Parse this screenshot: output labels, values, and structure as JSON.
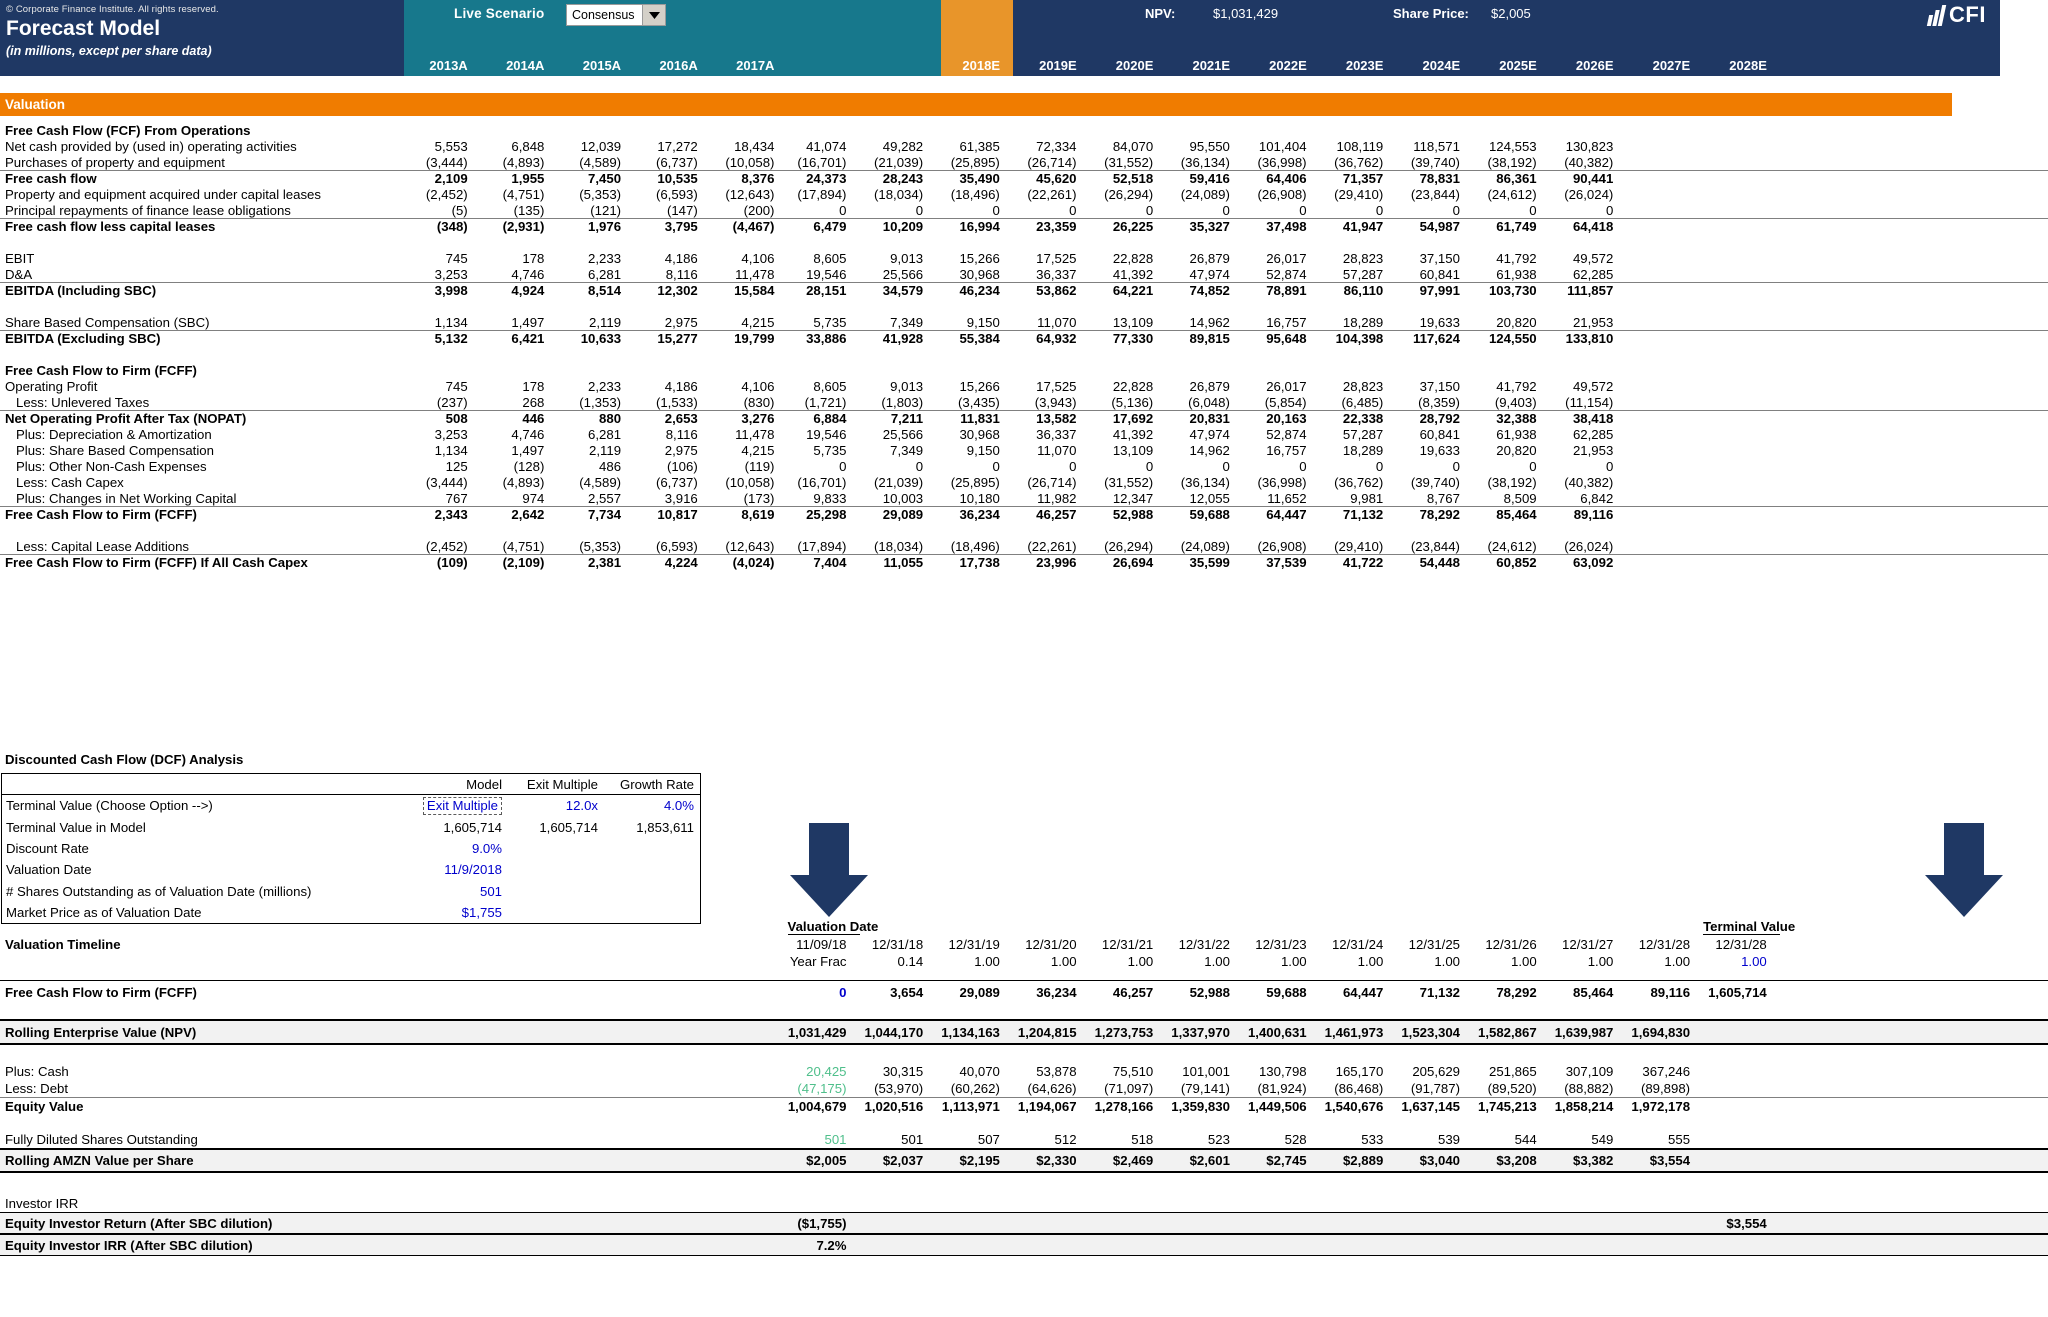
{
  "header": {
    "copyright": "© Corporate Finance Institute. All rights reserved.",
    "title": "Forecast Model",
    "subtitle": "(in millions, except per share data)",
    "live_scenario_label": "Live Scenario",
    "scenario_value": "Consensus",
    "npv_label": "NPV:",
    "npv_value": "$1,031,429",
    "share_price_label": "Share Price:",
    "share_price_value": "$2,005",
    "logo_text": "CFI"
  },
  "valuation_bar": "Valuation",
  "years": [
    "2013A",
    "2014A",
    "2015A",
    "2016A",
    "2017A",
    "2018E",
    "2019E",
    "2020E",
    "2021E",
    "2022E",
    "2023E",
    "2024E",
    "2025E",
    "2026E",
    "2027E",
    "2028E"
  ],
  "sections": {
    "fcf_ops": {
      "heading": "Free Cash Flow (FCF) From Operations",
      "rows": [
        {
          "label": "Net cash provided by (used in) operating activities",
          "values": [
            "5,553",
            "6,848",
            "12,039",
            "17,272",
            "18,434",
            "41,074",
            "49,282",
            "61,385",
            "72,334",
            "84,070",
            "95,550",
            "101,404",
            "108,119",
            "118,571",
            "124,553",
            "130,823"
          ]
        },
        {
          "label": "Purchases of property and equipment",
          "values": [
            "(3,444)",
            "(4,893)",
            "(4,589)",
            "(6,737)",
            "(10,058)",
            "(16,701)",
            "(21,039)",
            "(25,895)",
            "(26,714)",
            "(31,552)",
            "(36,134)",
            "(36,998)",
            "(36,762)",
            "(39,740)",
            "(38,192)",
            "(40,382)"
          ]
        },
        {
          "label": "Free cash flow",
          "bold": true,
          "rule": "top",
          "values": [
            "2,109",
            "1,955",
            "7,450",
            "10,535",
            "8,376",
            "24,373",
            "28,243",
            "35,490",
            "45,620",
            "52,518",
            "59,416",
            "64,406",
            "71,357",
            "78,831",
            "86,361",
            "90,441"
          ]
        },
        {
          "label": "Property and equipment acquired under capital leases",
          "values": [
            "(2,452)",
            "(4,751)",
            "(5,353)",
            "(6,593)",
            "(12,643)",
            "(17,894)",
            "(18,034)",
            "(18,496)",
            "(22,261)",
            "(26,294)",
            "(24,089)",
            "(26,908)",
            "(29,410)",
            "(23,844)",
            "(24,612)",
            "(26,024)"
          ]
        },
        {
          "label": "Principal repayments of finance lease obligations",
          "values": [
            "(5)",
            "(135)",
            "(121)",
            "(147)",
            "(200)",
            "0",
            "0",
            "0",
            "0",
            "0",
            "0",
            "0",
            "0",
            "0",
            "0",
            "0"
          ]
        },
        {
          "label": "Free cash flow less capital leases",
          "bold": true,
          "rule": "top",
          "values": [
            "(348)",
            "(2,931)",
            "1,976",
            "3,795",
            "(4,467)",
            "6,479",
            "10,209",
            "16,994",
            "23,359",
            "26,225",
            "35,327",
            "37,498",
            "41,947",
            "54,987",
            "61,749",
            "64,418"
          ]
        }
      ]
    },
    "ebitda": {
      "rows": [
        {
          "label": "EBIT",
          "values": [
            "745",
            "178",
            "2,233",
            "4,186",
            "4,106",
            "8,605",
            "9,013",
            "15,266",
            "17,525",
            "22,828",
            "26,879",
            "26,017",
            "28,823",
            "37,150",
            "41,792",
            "49,572"
          ]
        },
        {
          "label": "D&A",
          "values": [
            "3,253",
            "4,746",
            "6,281",
            "8,116",
            "11,478",
            "19,546",
            "25,566",
            "30,968",
            "36,337",
            "41,392",
            "47,974",
            "52,874",
            "57,287",
            "60,841",
            "61,938",
            "62,285"
          ]
        },
        {
          "label": "EBITDA (Including SBC)",
          "bold": true,
          "rule": "top",
          "values": [
            "3,998",
            "4,924",
            "8,514",
            "12,302",
            "15,584",
            "28,151",
            "34,579",
            "46,234",
            "53,862",
            "64,221",
            "74,852",
            "78,891",
            "86,110",
            "97,991",
            "103,730",
            "111,857"
          ]
        },
        {
          "label": "Share Based Compensation (SBC)",
          "spacer_before": true,
          "values": [
            "1,134",
            "1,497",
            "2,119",
            "2,975",
            "4,215",
            "5,735",
            "7,349",
            "9,150",
            "11,070",
            "13,109",
            "14,962",
            "16,757",
            "18,289",
            "19,633",
            "20,820",
            "21,953"
          ]
        },
        {
          "label": "EBITDA (Excluding SBC)",
          "bold": true,
          "rule": "top",
          "values": [
            "5,132",
            "6,421",
            "10,633",
            "15,277",
            "19,799",
            "33,886",
            "41,928",
            "55,384",
            "64,932",
            "77,330",
            "89,815",
            "95,648",
            "104,398",
            "117,624",
            "124,550",
            "133,810"
          ]
        }
      ]
    },
    "fcff": {
      "heading": "Free Cash Flow to Firm (FCFF)",
      "rows": [
        {
          "label": "Operating Profit",
          "values": [
            "745",
            "178",
            "2,233",
            "4,186",
            "4,106",
            "8,605",
            "9,013",
            "15,266",
            "17,525",
            "22,828",
            "26,879",
            "26,017",
            "28,823",
            "37,150",
            "41,792",
            "49,572"
          ]
        },
        {
          "label": "Less: Unlevered Taxes",
          "indent": true,
          "values": [
            "(237)",
            "268",
            "(1,353)",
            "(1,533)",
            "(830)",
            "(1,721)",
            "(1,803)",
            "(3,435)",
            "(3,943)",
            "(5,136)",
            "(6,048)",
            "(5,854)",
            "(6,485)",
            "(8,359)",
            "(9,403)",
            "(11,154)"
          ]
        },
        {
          "label": "Net Operating Profit After Tax (NOPAT)",
          "bold": true,
          "rule": "top",
          "values": [
            "508",
            "446",
            "880",
            "2,653",
            "3,276",
            "6,884",
            "7,211",
            "11,831",
            "13,582",
            "17,692",
            "20,831",
            "20,163",
            "22,338",
            "28,792",
            "32,388",
            "38,418"
          ]
        },
        {
          "label": "Plus: Depreciation & Amortization",
          "indent": true,
          "values": [
            "3,253",
            "4,746",
            "6,281",
            "8,116",
            "11,478",
            "19,546",
            "25,566",
            "30,968",
            "36,337",
            "41,392",
            "47,974",
            "52,874",
            "57,287",
            "60,841",
            "61,938",
            "62,285"
          ]
        },
        {
          "label": "Plus: Share Based Compensation",
          "indent": true,
          "values": [
            "1,134",
            "1,497",
            "2,119",
            "2,975",
            "4,215",
            "5,735",
            "7,349",
            "9,150",
            "11,070",
            "13,109",
            "14,962",
            "16,757",
            "18,289",
            "19,633",
            "20,820",
            "21,953"
          ]
        },
        {
          "label": "Plus: Other Non-Cash Expenses",
          "indent": true,
          "values": [
            "125",
            "(128)",
            "486",
            "(106)",
            "(119)",
            "0",
            "0",
            "0",
            "0",
            "0",
            "0",
            "0",
            "0",
            "0",
            "0",
            "0"
          ]
        },
        {
          "label": "Less: Cash Capex",
          "indent": true,
          "values": [
            "(3,444)",
            "(4,893)",
            "(4,589)",
            "(6,737)",
            "(10,058)",
            "(16,701)",
            "(21,039)",
            "(25,895)",
            "(26,714)",
            "(31,552)",
            "(36,134)",
            "(36,998)",
            "(36,762)",
            "(39,740)",
            "(38,192)",
            "(40,382)"
          ]
        },
        {
          "label": "Plus: Changes in Net Working Capital",
          "indent": true,
          "values": [
            "767",
            "974",
            "2,557",
            "3,916",
            "(173)",
            "9,833",
            "10,003",
            "10,180",
            "11,982",
            "12,347",
            "12,055",
            "11,652",
            "9,981",
            "8,767",
            "8,509",
            "6,842"
          ]
        },
        {
          "label": "Free Cash Flow to Firm (FCFF)",
          "bold": true,
          "rule": "top",
          "values": [
            "2,343",
            "2,642",
            "7,734",
            "10,817",
            "8,619",
            "25,298",
            "29,089",
            "36,234",
            "46,257",
            "52,988",
            "59,688",
            "64,447",
            "71,132",
            "78,292",
            "85,464",
            "89,116"
          ]
        },
        {
          "label": "Less: Capital Lease Additions",
          "indent": true,
          "spacer_before": true,
          "values": [
            "(2,452)",
            "(4,751)",
            "(5,353)",
            "(6,593)",
            "(12,643)",
            "(17,894)",
            "(18,034)",
            "(18,496)",
            "(22,261)",
            "(26,294)",
            "(24,089)",
            "(26,908)",
            "(29,410)",
            "(23,844)",
            "(24,612)",
            "(26,024)"
          ]
        },
        {
          "label": "Free Cash Flow to Firm (FCFF) If All Cash Capex",
          "bold": true,
          "rule": "top",
          "values": [
            "(109)",
            "(2,109)",
            "2,381",
            "4,224",
            "(4,024)",
            "7,404",
            "11,055",
            "17,738",
            "23,996",
            "26,694",
            "35,599",
            "37,539",
            "41,722",
            "54,448",
            "60,852",
            "63,092"
          ]
        }
      ]
    }
  },
  "dcf": {
    "title": "Discounted Cash Flow (DCF) Analysis",
    "columns": [
      "Model",
      "Exit Multiple",
      "Growth Rate"
    ],
    "rows": [
      {
        "label": "Terminal Value (Choose Option -->)",
        "model": "Exit Multiple",
        "model_style": "dashed-blue",
        "exit": "12.0x",
        "growth": "4.0%"
      },
      {
        "label": "Terminal Value in Model",
        "model": "1,605,714",
        "exit": "1,605,714",
        "growth": "1,853,611"
      },
      {
        "label": "Discount Rate",
        "model": "9.0%",
        "model_style": "blue",
        "exit": "",
        "growth": ""
      },
      {
        "label": "Valuation Date",
        "model": "11/9/2018",
        "model_style": "blue",
        "exit": "",
        "growth": ""
      },
      {
        "label": "# Shares Outstanding as of Valuation Date (millions)",
        "model": "501",
        "model_style": "blue",
        "exit": "",
        "growth": ""
      },
      {
        "label": "Market Price as of Valuation Date",
        "model": "$1,755",
        "model_style": "blue",
        "exit": "",
        "growth": ""
      }
    ]
  },
  "timeline": {
    "valuation_date_caption": "Valuation Date",
    "terminal_value_caption": "Terminal Value",
    "row_label": "Valuation Timeline",
    "year_frac_label": "Year Frac",
    "dates": [
      "11/09/18",
      "12/31/18",
      "12/31/19",
      "12/31/20",
      "12/31/21",
      "12/31/22",
      "12/31/23",
      "12/31/24",
      "12/31/25",
      "12/31/26",
      "12/31/27",
      "12/31/28",
      "12/31/28"
    ],
    "year_fracs": [
      "",
      "0.14",
      "1.00",
      "1.00",
      "1.00",
      "1.00",
      "1.00",
      "1.00",
      "1.00",
      "1.00",
      "1.00",
      "1.00",
      "1.00"
    ]
  },
  "valuation_rows": {
    "fcff": {
      "label": "Free Cash Flow to Firm (FCFF)",
      "values": [
        "0",
        "3,654",
        "29,089",
        "36,234",
        "46,257",
        "52,988",
        "59,688",
        "64,447",
        "71,132",
        "78,292",
        "85,464",
        "89,116",
        "1,605,714"
      ]
    },
    "rolling_ev": {
      "label": "Rolling Enterprise Value (NPV)",
      "values": [
        "1,031,429",
        "1,044,170",
        "1,134,163",
        "1,204,815",
        "1,273,753",
        "1,337,970",
        "1,400,631",
        "1,461,973",
        "1,523,304",
        "1,582,867",
        "1,639,987",
        "1,694,830",
        ""
      ]
    },
    "plus_cash": {
      "label": "Plus: Cash",
      "values": [
        "20,425",
        "30,315",
        "40,070",
        "53,878",
        "75,510",
        "101,001",
        "130,798",
        "165,170",
        "205,629",
        "251,865",
        "307,109",
        "367,246",
        ""
      ]
    },
    "less_debt": {
      "label": "Less: Debt",
      "values": [
        "(47,175)",
        "(53,970)",
        "(60,262)",
        "(64,626)",
        "(71,097)",
        "(79,141)",
        "(81,924)",
        "(86,468)",
        "(91,787)",
        "(89,520)",
        "(88,882)",
        "(89,898)",
        ""
      ]
    },
    "equity_value": {
      "label": "Equity Value",
      "values": [
        "1,004,679",
        "1,020,516",
        "1,113,971",
        "1,194,067",
        "1,278,166",
        "1,359,830",
        "1,449,506",
        "1,540,676",
        "1,637,145",
        "1,745,213",
        "1,858,214",
        "1,972,178",
        ""
      ]
    },
    "shares": {
      "label": "Fully Diluted Shares Outstanding",
      "values": [
        "501",
        "501",
        "507",
        "512",
        "518",
        "523",
        "528",
        "533",
        "539",
        "544",
        "549",
        "555",
        ""
      ]
    },
    "value_per_share": {
      "label": "Rolling AMZN Value per Share",
      "values": [
        "$2,005",
        "$2,037",
        "$2,195",
        "$2,330",
        "$2,469",
        "$2,601",
        "$2,745",
        "$2,889",
        "$3,040",
        "$3,208",
        "$3,382",
        "$3,554",
        ""
      ]
    }
  },
  "investor_irr": {
    "heading": "Investor IRR",
    "return_label": "Equity Investor Return (After SBC dilution)",
    "return_value": "($1,755)",
    "return_terminal": "$3,554",
    "irr_label": "Equity Investor IRR (After SBC dilution)",
    "irr_value": "7.2%"
  }
}
